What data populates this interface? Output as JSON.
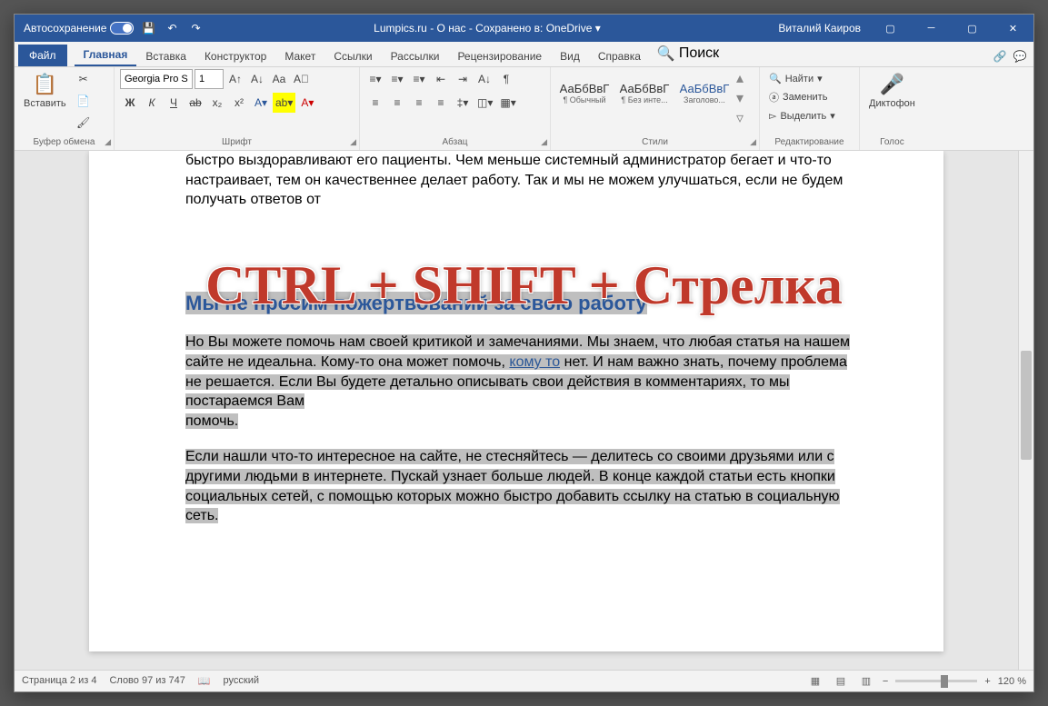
{
  "titlebar": {
    "autosave": "Автосохранение",
    "title": "Lumpics.ru - О нас  -  Сохранено в: OneDrive ▾",
    "user": "Виталий Каиров"
  },
  "tabs": {
    "file": "Файл",
    "home": "Главная",
    "insert": "Вставка",
    "design": "Конструктор",
    "layout": "Макет",
    "references": "Ссылки",
    "mailings": "Рассылки",
    "review": "Рецензирование",
    "view": "Вид",
    "help": "Справка",
    "search": "Поиск"
  },
  "ribbon": {
    "clipboard": {
      "label": "Буфер обмена",
      "paste": "Вставить"
    },
    "font": {
      "label": "Шрифт",
      "name": "Georgia Pro S",
      "size": "1",
      "bold": "Ж",
      "italic": "К",
      "underline": "Ч",
      "strike": "ab",
      "sub": "x₂",
      "sup": "x²"
    },
    "paragraph": {
      "label": "Абзац"
    },
    "styles": {
      "label": "Стили",
      "preview": "АаБбВвГ",
      "s1": "¶ Обычный",
      "s2": "¶ Без инте...",
      "s3": "Заголово..."
    },
    "editing": {
      "label": "Редактирование",
      "find": "Найти",
      "replace": "Заменить",
      "select": "Выделить"
    },
    "voice": {
      "label": "Голос",
      "dictate": "Диктофон"
    }
  },
  "document": {
    "p1": "быстро выздоравливают его пациенты. Чем меньше системный администратор бегает и что-то настраивает, тем он качественнее делает работу. Так и мы не можем улучшаться, если не будем получать ответов от",
    "h1": "Мы не просим пожертвований за свою работу",
    "p2a": "Но Вы можете помочь нам своей критикой и замечаниями. Мы знаем, что любая статья на нашем сайте не идеальна. Кому-то она может помочь, ",
    "p2link": "кому то",
    "p2b": " нет. И нам важно знать, почему проблема не решается. Если Вы будете детально описывать свои действия в комментариях, то мы постараемся Вам",
    "p2c": "помочь.",
    "p3": "Если нашли что-то интересное на сайте, не стесняйтесь — делитесь со своими друзьями или с другими людьми в интернете. Пускай узнает больше людей. В конце каждой статьи есть кнопки социальных сетей, с помощью которых можно быстро добавить ссылку на статью в социальную сеть."
  },
  "overlay": "CTRL + SHIFT + Стрелка",
  "status": {
    "page": "Страница 2 из 4",
    "words": "Слово 97 из 747",
    "lang": "русский",
    "zoom": "120 %"
  }
}
